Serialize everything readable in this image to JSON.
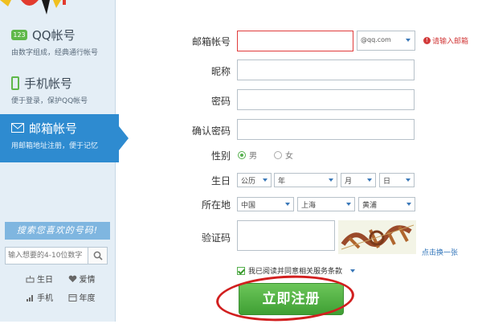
{
  "sidebar": {
    "items": [
      {
        "badge": "123",
        "title": "QQ帐号",
        "subtitle": "由数字组成，经典通行帐号",
        "icon": "number-badge-icon"
      },
      {
        "title": "手机帐号",
        "subtitle": "便于登录，保护QQ帐号",
        "icon": "phone-icon"
      },
      {
        "title": "邮箱帐号",
        "subtitle": "用邮箱地址注册，便于记忆",
        "icon": "mail-icon",
        "active": true
      }
    ],
    "search": {
      "title": "搜索您喜欢的号码!",
      "placeholder": "输入想要的4-10位数字"
    },
    "tags": [
      {
        "label": "生日",
        "icon": "cake-icon"
      },
      {
        "label": "爱情",
        "icon": "heart-icon"
      },
      {
        "label": "手机",
        "icon": "signal-icon"
      },
      {
        "label": "年度",
        "icon": "calendar-icon"
      }
    ]
  },
  "form": {
    "email_label": "邮箱帐号",
    "email_domain": "@qq.com",
    "email_error": "请输入邮箱",
    "nickname_label": "昵称",
    "password_label": "密码",
    "confirm_label": "确认密码",
    "gender_label": "性别",
    "gender_male": "男",
    "gender_female": "女",
    "birthday_label": "生日",
    "birthday": {
      "calendar": "公历",
      "year": "年",
      "month": "月",
      "day": "日"
    },
    "location_label": "所在地",
    "location": {
      "country": "中国",
      "city": "上海",
      "district": "黄浦"
    },
    "captcha_label": "验证码",
    "captcha_refresh": "点击换一张",
    "agree_text": "我已阅读并同意相关服务条款",
    "submit_label": "立即注册"
  },
  "colors": {
    "sidebar_bg": "#e4eef6",
    "active_tab": "#2e8bd0",
    "submit_green": "#4caf3f",
    "error_red": "#d23b3b",
    "annotation_red": "#d11f1f"
  }
}
